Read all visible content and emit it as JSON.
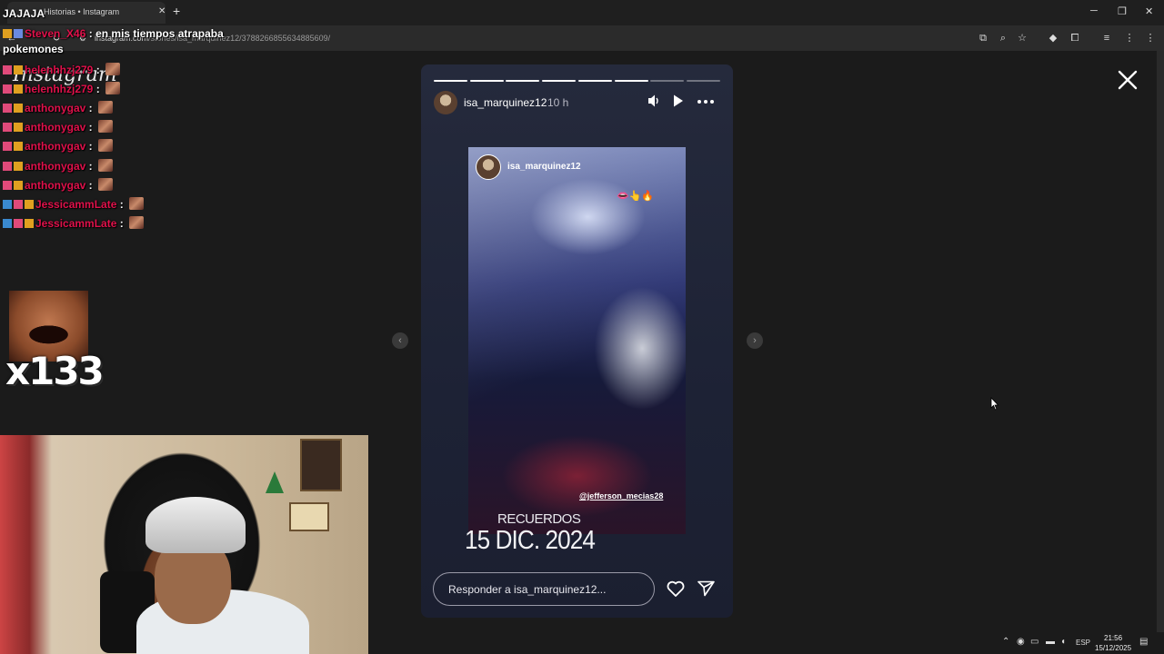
{
  "browser": {
    "tab_title": "Historias • Instagram",
    "url_host": "instagram.com",
    "url_path": "/stories/isa_marquinez12/3788266855634885609/"
  },
  "page": {
    "logo_text": "Instagram"
  },
  "story": {
    "username": "isa_marquinez12",
    "time_ago": "10 h",
    "progress_total": 8,
    "progress_filled": 6,
    "photo_username": "isa_marquinez12",
    "photo_emoji": "👄👆🔥",
    "photo_tag": "@jefferson_mecias28",
    "recuerdos_label": "RECUERDOS",
    "date_text": "15 DIC. 2024",
    "reply_placeholder": "Responder a isa_marquinez12..."
  },
  "chat": {
    "top_line_1": "JAJAJA",
    "top_line_2_user": "Steven_X46",
    "top_line_2_msg": "en mis tiempos atrapaba",
    "top_line_3": "pokemones",
    "messages": [
      {
        "user": "helenhhzj279",
        "sep": ":"
      },
      {
        "user": "helenhhzj279",
        "sep": ":"
      },
      {
        "user": "anthonygav",
        "sep": ":"
      },
      {
        "user": "anthonygav",
        "sep": ":"
      },
      {
        "user": "anthonygav",
        "sep": ":"
      },
      {
        "user": "anthonygav",
        "sep": ":"
      },
      {
        "user": "anthonygav",
        "sep": ":"
      },
      {
        "user": "JessicammLate",
        "sep": ":"
      },
      {
        "user": "JessicammLate",
        "sep": ":"
      }
    ],
    "combo_text": "x133"
  },
  "taskbar": {
    "lang": "ESP",
    "time": "21:56",
    "date": "15/12/2025"
  },
  "colors": {
    "chat_username": "#e0114b",
    "story_bg": "#252a3c"
  }
}
